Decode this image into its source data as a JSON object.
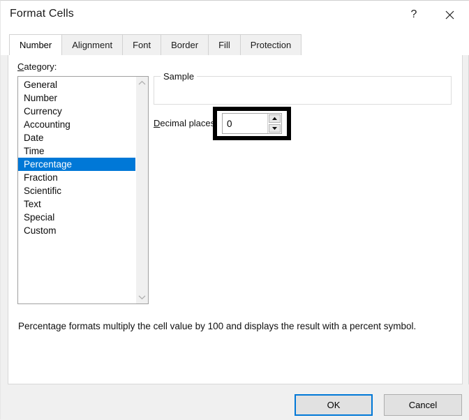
{
  "window": {
    "title": "Format Cells",
    "help_icon": "question-mark-icon",
    "help_glyph": "?",
    "close_icon": "close-x-icon"
  },
  "tabs": [
    {
      "label": "Number",
      "selected": true
    },
    {
      "label": "Alignment",
      "selected": false
    },
    {
      "label": "Font",
      "selected": false
    },
    {
      "label": "Border",
      "selected": false
    },
    {
      "label": "Fill",
      "selected": false
    },
    {
      "label": "Protection",
      "selected": false
    }
  ],
  "category": {
    "label_mnemonic": "C",
    "label_rest": "ategory:",
    "items": [
      "General",
      "Number",
      "Currency",
      "Accounting",
      "Date",
      "Time",
      "Percentage",
      "Fraction",
      "Scientific",
      "Text",
      "Special",
      "Custom"
    ],
    "selected": "Percentage",
    "scroll_up_icon": "chevron-up-icon",
    "scroll_down_icon": "chevron-down-icon"
  },
  "sample": {
    "legend": "Sample",
    "value": ""
  },
  "decimal_places": {
    "label_mnemonic": "D",
    "label_rest": "ecimal places:",
    "value": "0",
    "spin_up_icon": "spinner-up-arrow-icon",
    "spin_down_icon": "spinner-down-arrow-icon",
    "highlight_color": "#000000"
  },
  "description": "Percentage formats multiply the cell value by 100 and displays the result with a percent symbol.",
  "footer": {
    "ok_label": "OK",
    "cancel_label": "Cancel",
    "focus_color": "#0078d7"
  },
  "colors": {
    "selection_blue": "#0078d7",
    "dialog_background": "#f0f0f0",
    "content_background": "#ffffff"
  }
}
